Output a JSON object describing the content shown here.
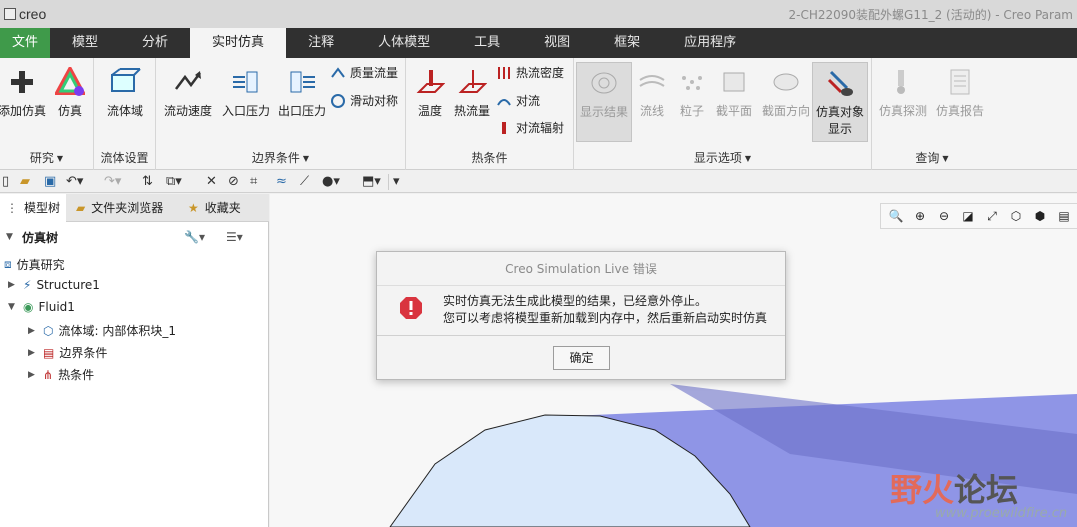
{
  "app": {
    "logo_text": "creo",
    "window_title": "2-CH22090装配外螺G11_2 (活动的) - Creo Param"
  },
  "tabs": [
    "文件",
    "模型",
    "分析",
    "实时仿真",
    "注释",
    "人体模型",
    "工具",
    "视图",
    "框架",
    "应用程序"
  ],
  "ribbon": {
    "groups": {
      "study": "研究",
      "fluid_setup": "流体设置",
      "boundary": "边界条件",
      "thermal": "热条件",
      "display": "显示选项",
      "query": "查询"
    },
    "buttons": {
      "add_sim": "添加仿真",
      "simulate": "仿真",
      "fluid_domain": "流体域",
      "flow_velocity": "流动速度",
      "inlet_pressure": "入口压力",
      "outlet_pressure": "出口压力",
      "mass_flow": "质量流量",
      "slip_symmetry": "滑动对称",
      "temperature": "温度",
      "heat_flow": "热流量",
      "heat_flux": "热流密度",
      "convection": "对流",
      "convection_radiation": "对流辐射",
      "show_results": "显示结果",
      "streamline": "流线",
      "particle": "粒子",
      "cut_plane": "截平面",
      "cut_direction": "截面方向",
      "sim_object_display_1": "仿真对象",
      "sim_object_display_2": "显示",
      "sim_probe": "仿真探测",
      "sim_report": "仿真报告"
    }
  },
  "panel": {
    "tabs": [
      "模型树",
      "文件夹浏览器",
      "收藏夹"
    ],
    "tree_title": "仿真树",
    "items": [
      "仿真研究",
      "Structure1",
      "Fluid1",
      "流体域: 内部体积块_1",
      "边界条件",
      "热条件"
    ]
  },
  "dialog": {
    "title": "Creo Simulation Live 错误",
    "line1": "实时仿真无法生成此模型的结果，已经意外停止。",
    "line2": "您可以考虑将模型重新加载到内存中，然后重新启动实时仿真",
    "ok": "确定"
  },
  "watermark": {
    "text_red": "野火",
    "text_dark": "论坛",
    "url": "www.proewildfire.cn"
  },
  "colors": {
    "file_tab": "#3f9a4a",
    "tab_bar": "#303030",
    "error_red": "#d9343f",
    "model_blue": "#8f95e6"
  }
}
